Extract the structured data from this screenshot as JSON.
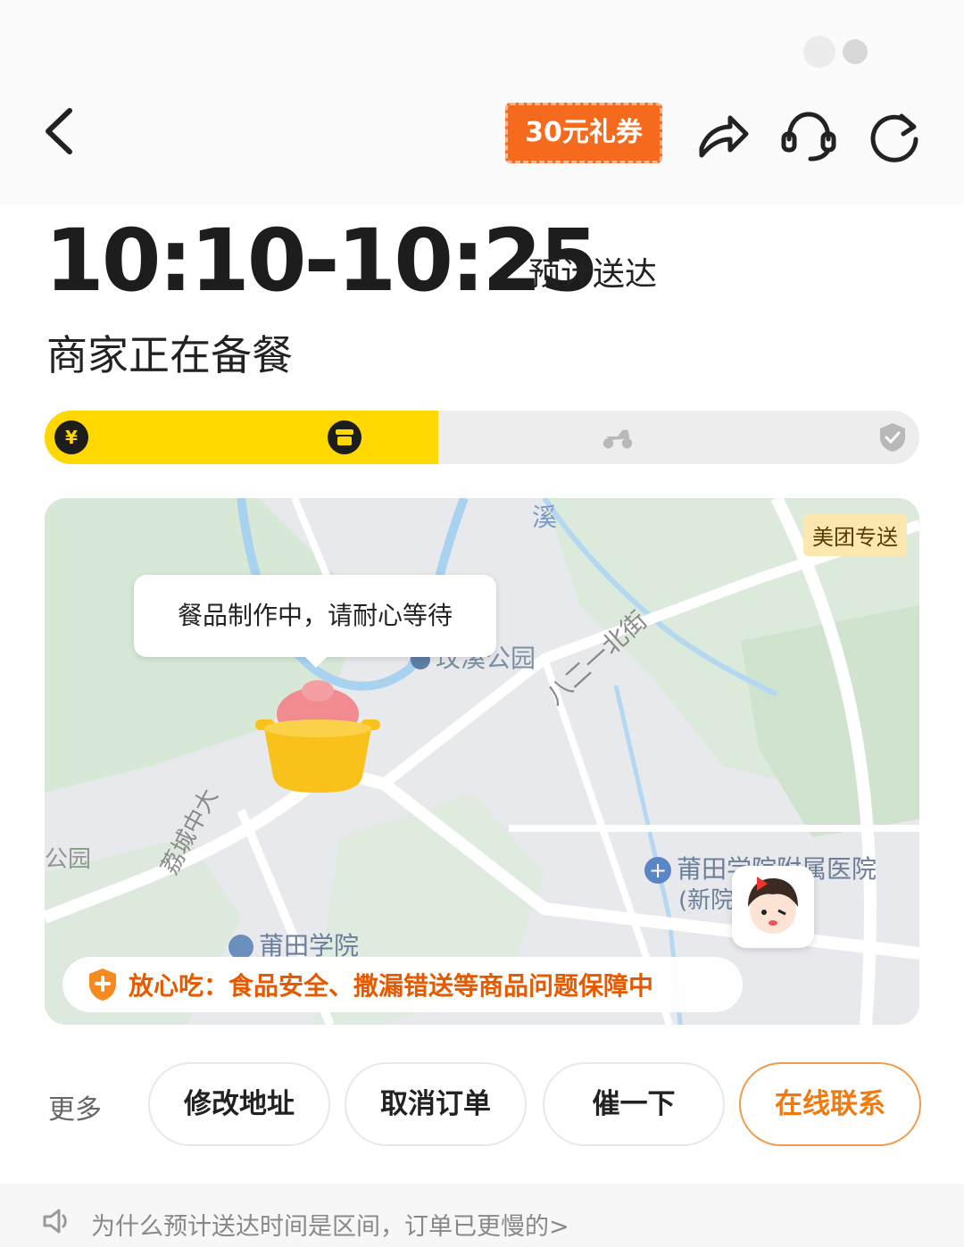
{
  "header": {
    "back_icon": "chevron-left-icon",
    "coupon_label": "30元礼券",
    "share_icon": "share-icon",
    "support_icon": "headset-icon",
    "refresh_icon": "refresh-icon"
  },
  "order": {
    "eta_time": "10:10-10:25",
    "eta_label": "预计送达",
    "status_title": "商家正在备餐"
  },
  "progress": {
    "fraction": 0.45,
    "steps": [
      {
        "name": "paid",
        "icon": "yen-icon",
        "active": true
      },
      {
        "name": "preparing",
        "icon": "shop-icon",
        "active": true
      },
      {
        "name": "delivering",
        "icon": "scooter-icon",
        "active": false
      },
      {
        "name": "delivered",
        "icon": "check-badge-icon",
        "active": false
      }
    ],
    "active_color": "#ffd800",
    "inactive_color": "#ededed"
  },
  "map": {
    "delivery_tag": "美团专送",
    "bubble_text": "餐品制作中，请耐心等待",
    "labels": {
      "park": "玟溪公园",
      "street": "八二一北街",
      "hospital": "莆田学院附属医院",
      "hospital_sub": "(新院",
      "college": "莆田学院",
      "road": "荔城中大",
      "park_left": "公园",
      "river": "溪"
    },
    "safety_text": "放心吃：食品安全、撒漏错送等商品问题保障中"
  },
  "actions": {
    "more_label": "更多",
    "buttons": [
      "修改地址",
      "取消订单",
      "催一下",
      "在线联系"
    ]
  },
  "notice": {
    "icon": "speaker-icon",
    "text": "为什么预计送达时间是区间，订单已更慢的>"
  },
  "colors": {
    "accent": "#ffd800",
    "orange": "#f07a10",
    "coupon_bg": "#f66a1d"
  }
}
